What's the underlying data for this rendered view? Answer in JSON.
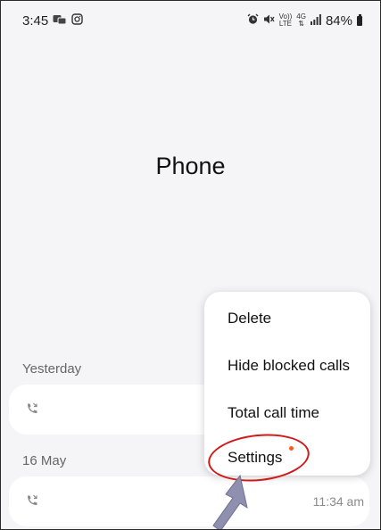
{
  "status_bar": {
    "time": "3:45",
    "battery": "84%",
    "volte_label": "Vo))",
    "lte_label": "LTE",
    "net_label": "4G"
  },
  "header": {
    "title": "Phone"
  },
  "sections": [
    {
      "label": "Yesterday",
      "entries": [
        {
          "time": ""
        }
      ]
    },
    {
      "label": "16 May",
      "entries": [
        {
          "time": "11:34 am"
        }
      ]
    }
  ],
  "menu": {
    "items": [
      {
        "label": "Delete"
      },
      {
        "label": "Hide blocked calls"
      },
      {
        "label": "Total call time"
      },
      {
        "label": "Settings"
      }
    ]
  },
  "colors": {
    "background": "#f5f5f7",
    "highlight": "#d11a1a",
    "badge": "#ff5a1f",
    "arrow": "#8f8fb0"
  }
}
